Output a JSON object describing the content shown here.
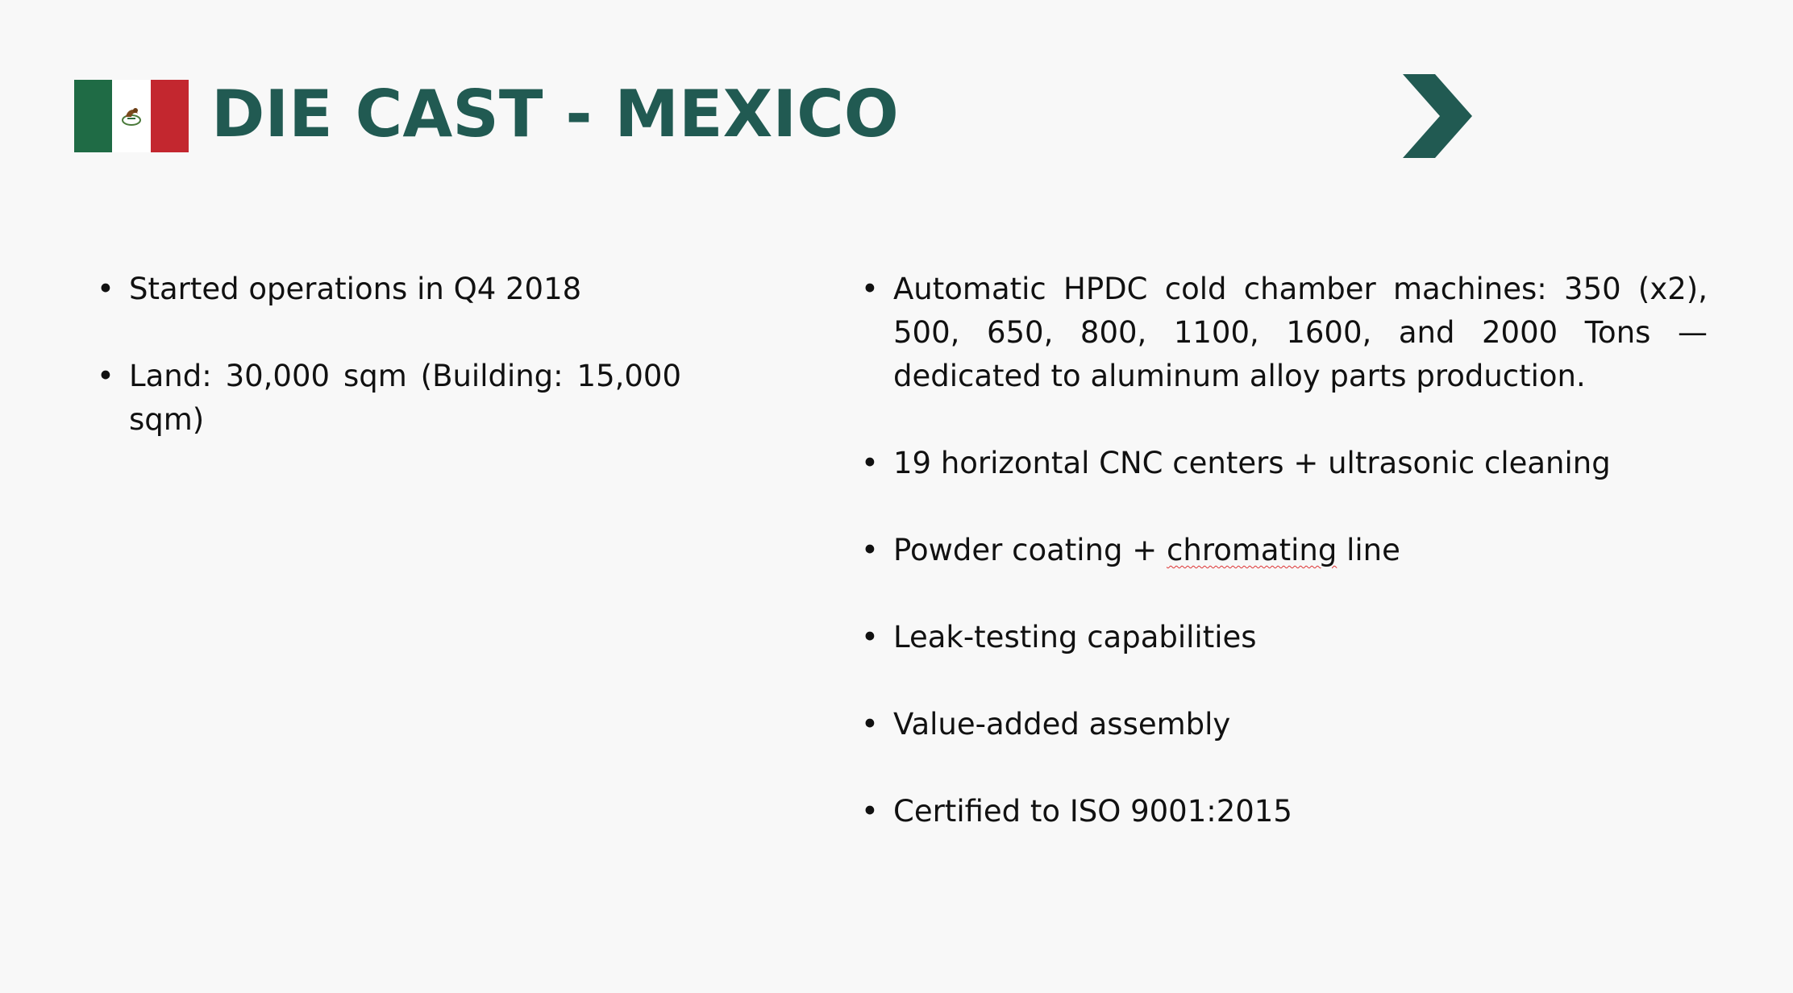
{
  "slide": {
    "title": "DIE CAST - MEXICO",
    "flag_icon": "mexico-flag-icon",
    "chevron_icon": "chevron-right-icon",
    "colors": {
      "title": "#215a52",
      "chevron": "#215a52",
      "flag_green": "#1f6b45",
      "flag_red": "#c3272f",
      "background": "#f8f8f8"
    }
  },
  "left_bullets": [
    "Started operations in Q4 2018",
    "Land: 30,000 sqm (Building: 15,000 sqm)"
  ],
  "right_bullets": [
    "Automatic HPDC cold chamber machines: 350 (x2), 500, 650, 800, 1100, 1600, and 2000 Tons — dedicated to aluminum alloy parts production.",
    "19 horizontal CNC centers + ultrasonic cleaning",
    {
      "before": "Powder coating + ",
      "flagged": "chromating",
      "after": " line"
    },
    "Leak-testing capabilities",
    "Value-added assembly",
    "Certified to ISO 9001:2015"
  ],
  "bullet_char": "•"
}
